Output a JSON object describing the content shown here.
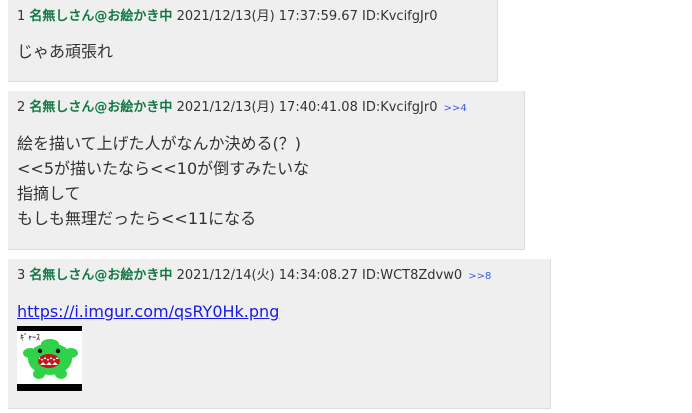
{
  "posts": [
    {
      "number": "1",
      "name": "名無しさん@お絵かき中",
      "datetime": "2021/12/13(月) 17:37:59.67",
      "id": "ID:KvcifgJr0",
      "lines": [
        "じゃあ頑張れ"
      ]
    },
    {
      "number": "2",
      "name": "名無しさん@お絵かき中",
      "datetime": "2021/12/13(月) 17:40:41.08",
      "id": "ID:KvcifgJr0",
      "refs": ">>4",
      "lines": [
        "絵を描いて上げた人がなんか決める(？)",
        "<<5が描いたなら<<10が倒すみたいな",
        "指摘して",
        "もしも無理だったら<<11になる"
      ]
    },
    {
      "number": "3",
      "name": "名無しさん@お絵かき中",
      "datetime": "2021/12/14(火) 14:34:08.27",
      "id": "ID:WCT8Zdvw0",
      "refs": ">>8",
      "link": "https://i.imgur.com/qsRY0Hk.png",
      "thumbnail": {
        "caption": "ｷﾞｬｰｽ",
        "monster_color": "#2fd34a"
      }
    }
  ]
}
